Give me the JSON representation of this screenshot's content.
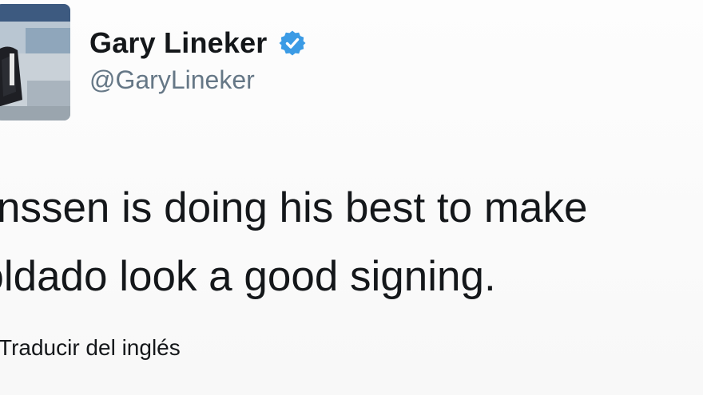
{
  "tweet": {
    "author": {
      "name": "Gary Lineker",
      "handle": "@GaryLineker",
      "verified": true,
      "verified_color": "#3b9be5"
    },
    "text_lines": [
      "Janssen is doing his best to make",
      "Soldado look a good signing."
    ],
    "translate_label": "Traducir del inglés"
  },
  "icons": {
    "verified": "verified-badge-icon",
    "avatar": "user-avatar-photo"
  },
  "colors": {
    "text": "#14171a",
    "secondary": "#657786",
    "background": "#ffffff"
  }
}
